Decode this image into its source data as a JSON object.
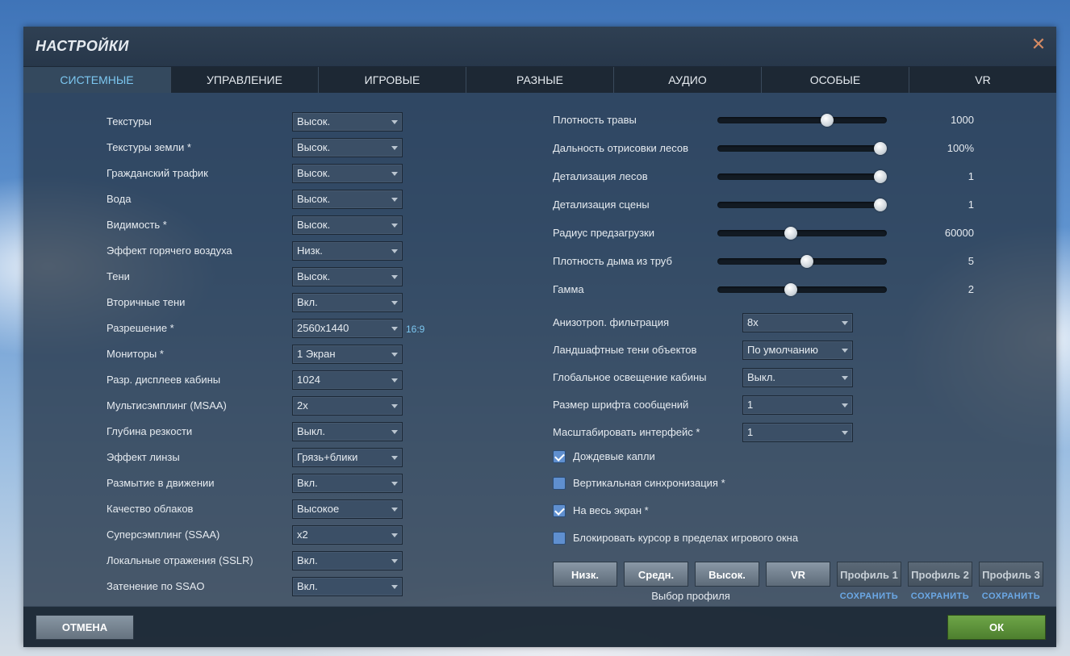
{
  "title": "НАСТРОЙКИ",
  "close_icon": "close-icon",
  "tabs": [
    {
      "label": "СИСТЕМНЫЕ",
      "active": true
    },
    {
      "label": "УПРАВЛЕНИЕ"
    },
    {
      "label": "ИГРОВЫЕ"
    },
    {
      "label": "РАЗНЫЕ"
    },
    {
      "label": "АУДИО"
    },
    {
      "label": "ОСОБЫЕ"
    },
    {
      "label": "VR"
    }
  ],
  "left_settings": [
    {
      "label": "Текстуры",
      "value": "Высок."
    },
    {
      "label": "Текстуры земли *",
      "value": "Высок."
    },
    {
      "label": "Гражданский трафик",
      "value": "Высок."
    },
    {
      "label": "Вода",
      "value": "Высок."
    },
    {
      "label": "Видимость *",
      "value": "Высок."
    },
    {
      "label": "Эффект горячего воздуха",
      "value": "Низк."
    },
    {
      "label": "Тени",
      "value": "Высок."
    },
    {
      "label": "Вторичные тени",
      "value": "Вкл."
    },
    {
      "label": "Разрешение *",
      "value": "2560x1440"
    },
    {
      "label": "Мониторы *",
      "value": "1 Экран"
    },
    {
      "label": "Разр. дисплеев кабины",
      "value": "1024"
    },
    {
      "label": "Мультисэмплинг (MSAA)",
      "value": "2x"
    },
    {
      "label": "Глубина резкости",
      "value": "Выкл."
    },
    {
      "label": "Эффект линзы",
      "value": "Грязь+блики"
    },
    {
      "label": "Размытие в движении",
      "value": "Вкл."
    },
    {
      "label": "Качество облаков",
      "value": "Высокое"
    },
    {
      "label": "Суперсэмплинг (SSAA)",
      "value": "x2"
    },
    {
      "label": "Локальные отражения (SSLR)",
      "value": "Вкл."
    },
    {
      "label": "Затенение по SSAO",
      "value": "Вкл."
    }
  ],
  "resolution_aspect": "16:9",
  "sliders": [
    {
      "label": "Плотность травы",
      "value": "1000",
      "fraction": 0.66
    },
    {
      "label": "Дальность отрисовки лесов",
      "value": "100%",
      "fraction": 1.0
    },
    {
      "label": "Детализация лесов",
      "value": "1",
      "fraction": 1.0
    },
    {
      "label": "Детализация сцены",
      "value": "1",
      "fraction": 1.0
    },
    {
      "label": "Радиус предзагрузки",
      "value": "60000",
      "fraction": 0.43
    },
    {
      "label": "Плотность дыма из труб",
      "value": "5",
      "fraction": 0.53
    },
    {
      "label": "Гамма",
      "value": "2",
      "fraction": 0.43
    }
  ],
  "right_settings": [
    {
      "label": "Анизотроп. фильтрация",
      "value": "8x"
    },
    {
      "label": "Ландшафтные тени объектов",
      "value": "По умолчанию"
    },
    {
      "label": "Глобальное освещение кабины",
      "value": "Выкл."
    },
    {
      "label": "Размер шрифта сообщений",
      "value": "1"
    },
    {
      "label": "Масштабировать интерфейс *",
      "value": "1"
    }
  ],
  "checkboxes": [
    {
      "label": "Дождевые капли",
      "checked": true
    },
    {
      "label": "Вертикальная синхронизация *",
      "checked": false
    },
    {
      "label": "На весь экран *",
      "checked": true
    },
    {
      "label": "Блокировать курсор в пределах игрового окна",
      "checked": false
    }
  ],
  "presets": [
    "Низк.",
    "Средн.",
    "Высок.",
    "VR"
  ],
  "profiles": [
    "Профиль 1",
    "Профиль 2",
    "Профиль 3"
  ],
  "save_label": "СОХРАНИТЬ",
  "profile_caption": "Выбор профиля",
  "footer": {
    "cancel": "ОТМЕНА",
    "ok": "ОК"
  }
}
